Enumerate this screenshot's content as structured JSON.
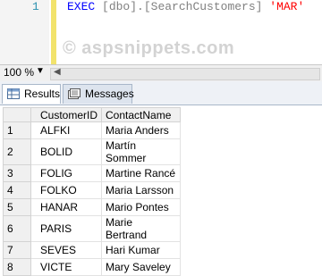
{
  "editor": {
    "line_number": "1",
    "code_keyword": "EXEC",
    "code_object": "[dbo].[SearchCustomers]",
    "code_string": "'MAR'",
    "watermark": "© aspsnippets.com"
  },
  "statusbar": {
    "zoom": "100 %"
  },
  "tabs": [
    {
      "label": "Results"
    },
    {
      "label": "Messages"
    }
  ],
  "grid": {
    "columns": [
      "CustomerID",
      "ContactName"
    ],
    "rows": [
      {
        "n": "1",
        "id": "ALFKI",
        "name": "Maria Anders"
      },
      {
        "n": "2",
        "id": "BOLID",
        "name": "Martín Sommer"
      },
      {
        "n": "3",
        "id": "FOLIG",
        "name": "Martine Rancé"
      },
      {
        "n": "4",
        "id": "FOLKO",
        "name": "Maria Larsson"
      },
      {
        "n": "5",
        "id": "HANAR",
        "name": "Mario Pontes"
      },
      {
        "n": "6",
        "id": "PARIS",
        "name": "Marie Bertrand"
      },
      {
        "n": "7",
        "id": "SEVES",
        "name": "Hari Kumar"
      },
      {
        "n": "8",
        "id": "VICTE",
        "name": "Mary Saveley"
      }
    ]
  }
}
